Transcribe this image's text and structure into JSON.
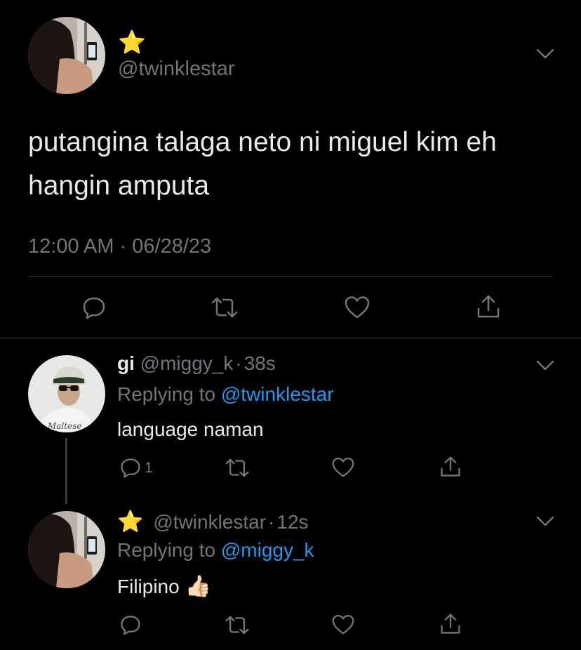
{
  "main_tweet": {
    "name_emoji": "⭐",
    "handle": "@twinklestar",
    "text_line1": "putangina talaga neto ni miguel kim eh",
    "text_line2": "hangin amputa",
    "timestamp": "12:00 AM · 06/28/23"
  },
  "reply1": {
    "name": "gi",
    "handle": "@miggy_k",
    "separator": "·",
    "time": "38s",
    "replying_prefix": "Replying to",
    "replying_to": "@twinklestar",
    "text": "language naman",
    "reply_count": "1",
    "avatar_shirt_text": "Maltese"
  },
  "reply2": {
    "name_emoji": "⭐",
    "handle": "@twinklestar",
    "separator": "·",
    "time": "12s",
    "replying_prefix": "Replying to",
    "replying_to": "@miggy_k",
    "text": "Filipino",
    "text_emoji": "👍🏻"
  },
  "colors": {
    "background": "#000000",
    "text": "#e7e9ea",
    "muted": "#71767b",
    "link": "#1d9bf0",
    "divider": "#2f3336",
    "star": "#f5c518"
  },
  "icons": [
    "chevron-down-icon",
    "reply-icon",
    "retweet-icon",
    "like-icon",
    "share-icon",
    "star-icon",
    "thumbs-up-icon"
  ]
}
